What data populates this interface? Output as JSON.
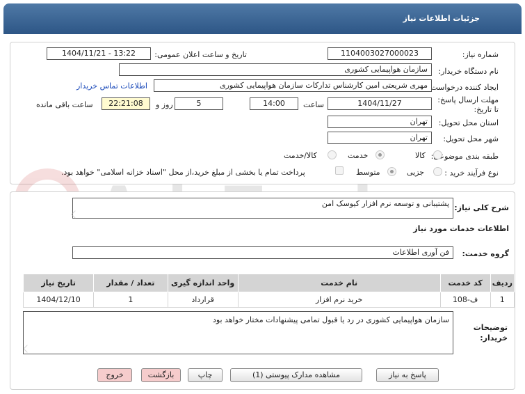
{
  "header": {
    "title": "جزئیات اطلاعات نیاز"
  },
  "fields": {
    "need_number_label": "شماره نیاز:",
    "need_number": "1104003027000023",
    "announce_label": "تاریخ و ساعت اعلان عمومی:",
    "announce_value": "1404/11/21 - 13:22",
    "buyer_org_label": "نام دستگاه خریدار:",
    "buyer_org": "سازمان هواپیمایی کشوری",
    "creator_label": "ایجاد کننده درخواست:",
    "creator": "مهری شریعتی امین کارشناس تدارکات سازمان هواپیمایی کشوری",
    "contact_link": "اطلاعات تماس خریدار",
    "deadline_label": "مهلت ارسال پاسخ: تا تاریخ:",
    "deadline_date": "1404/11/27",
    "time_label": "ساعت",
    "deadline_time": "14:00",
    "days_value": "5",
    "days_label": "روز و",
    "remaining_time": "22:21:08",
    "remaining_label": "ساعت باقی مانده",
    "province_label": "استان محل تحویل:",
    "province": "تهران",
    "city_label": "شهر محل تحویل:",
    "city": "تهران",
    "category_label": "طبقه بندی موضوعی:",
    "category_options": [
      "کالا",
      "خدمت",
      "کالا/خدمت"
    ],
    "process_label": "نوع فرآیند خرید :",
    "process_options": [
      "جزیی",
      "متوسط"
    ],
    "payment_note": "پرداخت تمام یا بخشی از مبلغ خرید،از محل \"اسناد خزانه اسلامی\" خواهد بود."
  },
  "summary": {
    "label": "شرح کلی نیاز:",
    "value": "پشتیبانی و توسعه نرم افزار کیوسک امن"
  },
  "services_section": {
    "title": "اطلاعات خدمات مورد نیاز",
    "group_label": "گروه خدمت:",
    "group_value": "فن آوری اطلاعات"
  },
  "table": {
    "headers": [
      "ردیف",
      "کد خدمت",
      "نام خدمت",
      "واحد اندازه گیری",
      "تعداد / مقدار",
      "تاریخ نیاز"
    ],
    "rows": [
      [
        "1",
        "ف-108",
        "خرید نرم افزار",
        "قرارداد",
        "1",
        "1404/12/10"
      ]
    ]
  },
  "buyer_notes": {
    "label": "توضیحات خریدار:",
    "value": "سازمان هواپیمایی کشوری در رد یا قبول تمامی پیشنهادات مختار خواهد بود"
  },
  "buttons": {
    "reply": "پاسخ به نیاز",
    "attachments": "مشاهده مدارک پیوستی (1)",
    "print": "چاپ",
    "back": "بازگشت",
    "exit": "خروج"
  },
  "watermark": {
    "text": "AriaTender.neT"
  },
  "colors": {
    "header": "#2d5686",
    "link": "#1646b8",
    "highlight": "#fffbd0",
    "pink_button": "#f6cccc",
    "table_header": "#d4d4d4"
  }
}
